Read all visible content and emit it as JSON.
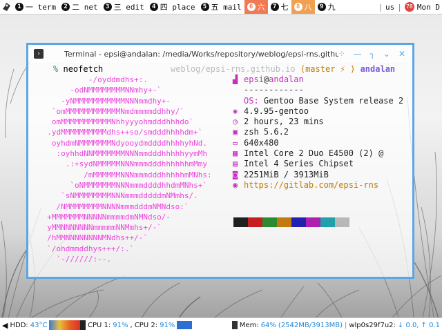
{
  "topbar": {
    "workspaces": [
      {
        "num": "1",
        "label": "一 term",
        "state": "normal"
      },
      {
        "num": "2",
        "label": "二 net",
        "state": "normal"
      },
      {
        "num": "3",
        "label": "三 edit",
        "state": "normal"
      },
      {
        "num": "4",
        "label": "四 place",
        "state": "normal"
      },
      {
        "num": "5",
        "label": "五 mail",
        "state": "normal"
      },
      {
        "num": "6",
        "label": "六",
        "state": "active"
      },
      {
        "num": "7",
        "label": "七",
        "state": "normal"
      },
      {
        "num": "8",
        "label": "八",
        "state": "urgent"
      },
      {
        "num": "9",
        "label": "九",
        "state": "normal"
      }
    ],
    "layout": "us",
    "notif_count": "78",
    "clock": "Mon D"
  },
  "window": {
    "title": "Terminal - epsi@andalan: /media/Works/repository/weblog/epsi-rns.github.io",
    "controls": [
      "⁘",
      "—",
      "┐",
      "⌄",
      "✕"
    ]
  },
  "terminal": {
    "prompt_symbol": "%",
    "command": "neofetch",
    "rprompt_path": "weblog/epsi-rns.github.io",
    "rprompt_branch": "(master ⚡ )",
    "rprompt_host": "andalan",
    "ascii_art": [
      "           -/oyddmdhs+:.",
      "       -odNMMMMMMMMNNmhy+-`",
      "     -yNMMMMMMMMMMMNNNmmdhy+-",
      "   `omMMMMMMMMMMMMNmdmmmmddhhy/`",
      "   omMMMMMMMMMMMNhhyyyohmdddhhhdo`",
      "  .ydMMMMMMMMMMdhs++so/smdddhhhhdm+`",
      "   oyhdmNMMMMMMMNdyooydmddddhhhhyhNd.",
      "    :oyhhdNNMMMMMMMNNNmmdddhhhhhyymMh",
      "      .:+sydNMMMMMNNNmmmdddhhhhhhmMmy",
      "          /mMMMMMMNNNmmmdddhhhhhmMNhs:",
      "       `oNMMMMMMMNNNmmmddddhhdmMNhs+`",
      "     `sNMMMMMMMMNNNmmmdddddmNMmhs/.",
      "    /NMMMMMMMMNNNNmmmdddmNMNdso:`",
      "  +MMMMMMMNNNNNmmmmdmNMNdso/-",
      "  yMMNNNNNNNmmmmmNNMmhs+/-`",
      "  /hMMNNNNNNNNMNdhs++/-`",
      "  `/ohdmmddhys+++/:.`",
      "    `-//////:--."
    ],
    "info": [
      {
        "icon": "▟",
        "key": "",
        "value": ""
      },
      {
        "icon": "",
        "key": "",
        "value": "------------"
      },
      {
        "icon": "",
        "key": "OS:",
        "value": " Gentoo Base System release 2"
      },
      {
        "icon": "✺",
        "key": "",
        "value": "4.9.95-gentoo"
      },
      {
        "icon": "◷",
        "key": "",
        "value": "2 hours, 23 mins"
      },
      {
        "icon": "▣",
        "key": "",
        "value": "zsh 5.6.2"
      },
      {
        "icon": "▭",
        "key": "",
        "value": "640x480"
      },
      {
        "icon": "▦",
        "key": "",
        "value": "Intel Core 2 Duo E4500 (2) @"
      },
      {
        "icon": "▤",
        "key": "",
        "value": "Intel 4 Series Chipset"
      },
      {
        "icon": "◙",
        "key": "",
        "value": "2251MiB / 3913MiB"
      },
      {
        "icon": "◉",
        "key": "",
        "value": "https://gitlab.com/epsi-rns"
      }
    ],
    "user": "epsi",
    "at": "@",
    "host": "andalan",
    "palette": [
      "#1f1f1f",
      "#c41e1e",
      "#2e8a2e",
      "#c07a10",
      "#2222b0",
      "#b020b0",
      "#20a0a8",
      "#b8b8b8"
    ]
  },
  "bottombar": {
    "hdd_label": "HDD:",
    "hdd_temp": "43°C",
    "cpu_label": "CPU 1:",
    "cpu1": "91%",
    "cpu2_label": ", CPU 2:",
    "cpu2": "91%",
    "mem_label": "Mem:",
    "mem_pct": "64%",
    "mem_detail": "(2542MB/3913MB)",
    "net_iface": "wlp0s29f7u2:",
    "net_down": "↓ 0.0,",
    "net_up": "↑ 0.1"
  }
}
